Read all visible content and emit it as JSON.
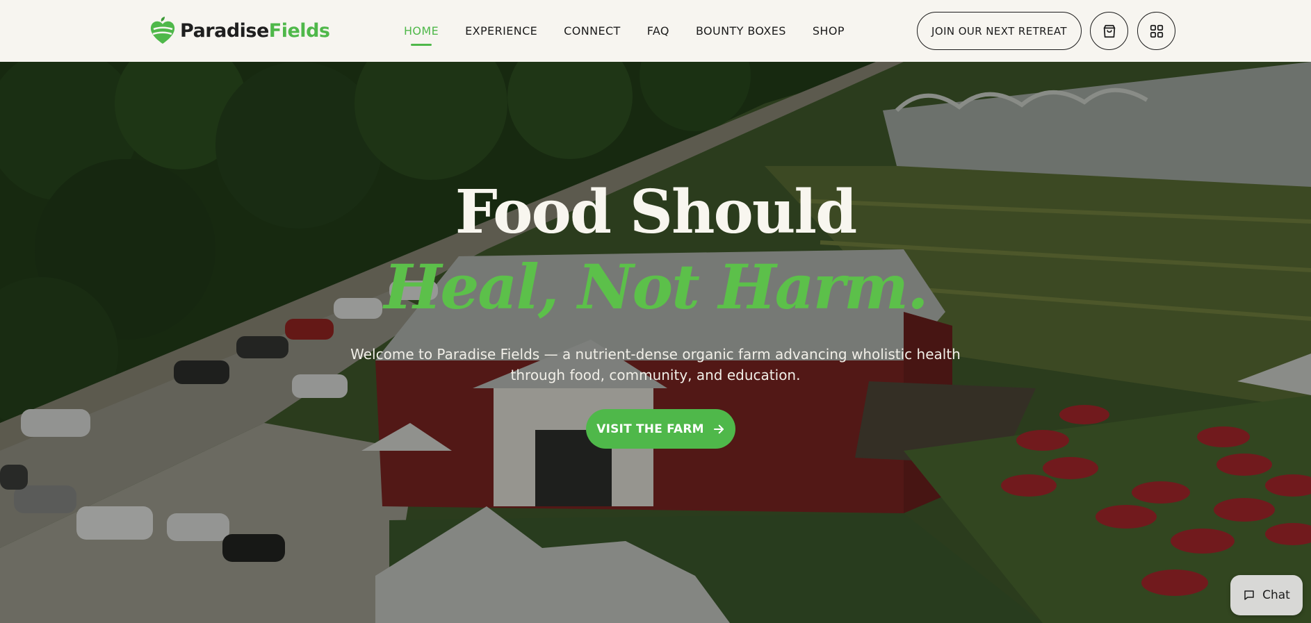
{
  "brand": {
    "name_part1": "Paradise",
    "name_part2": "Fields",
    "logo_icon": "leaf-heart-icon",
    "accent_color": "#4fb84a"
  },
  "nav": {
    "items": [
      {
        "label": "HOME",
        "active": true
      },
      {
        "label": "EXPERIENCE",
        "active": false
      },
      {
        "label": "CONNECT",
        "active": false
      },
      {
        "label": "FAQ",
        "active": false
      },
      {
        "label": "BOUNTY BOXES",
        "active": false
      },
      {
        "label": "SHOP",
        "active": false
      }
    ]
  },
  "header_actions": {
    "retreat_label": "JOIN OUR NEXT RETREAT",
    "cart_icon": "shopping-bag-icon",
    "menu_icon": "grid-icon"
  },
  "hero": {
    "headline_line1": "Food Should",
    "headline_line2": "Heal, Not Harm.",
    "subtitle": "Welcome to Paradise Fields — a nutrient-dense organic farm advancing wholistic health through food, community, and education.",
    "cta_label": "VISIT THE FARM",
    "cta_icon": "arrow-right-icon",
    "background": "aerial-farm-photo"
  },
  "chat": {
    "label": "Chat",
    "icon": "chat-bubble-icon"
  }
}
